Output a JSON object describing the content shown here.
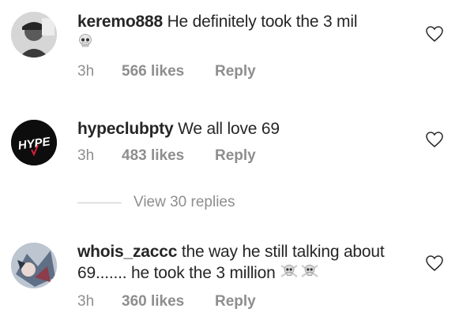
{
  "comments": [
    {
      "username": "keremo888",
      "text": "He definitely took the 3 mil",
      "emoji": "skull-emoji",
      "time": "3h",
      "likes": "566 likes",
      "reply": "Reply"
    },
    {
      "username": "hypeclubpty",
      "text": "We all love 69",
      "avatar_text": "HYPE",
      "time": "3h",
      "likes": "483 likes",
      "reply": "Reply"
    },
    {
      "username": "whois_zaccc",
      "text": "the way he still talking about 69....... he took the 3 million",
      "emoji": "skull-crossbones-emoji",
      "time": "3h",
      "likes": "360 likes",
      "reply": "Reply"
    }
  ],
  "view_replies": "View 30 replies",
  "icons": {
    "like": "heart-outline-icon"
  },
  "colors": {
    "text": "#262626",
    "muted": "#8e8e8e",
    "hype_accent": "#d81e3a"
  }
}
